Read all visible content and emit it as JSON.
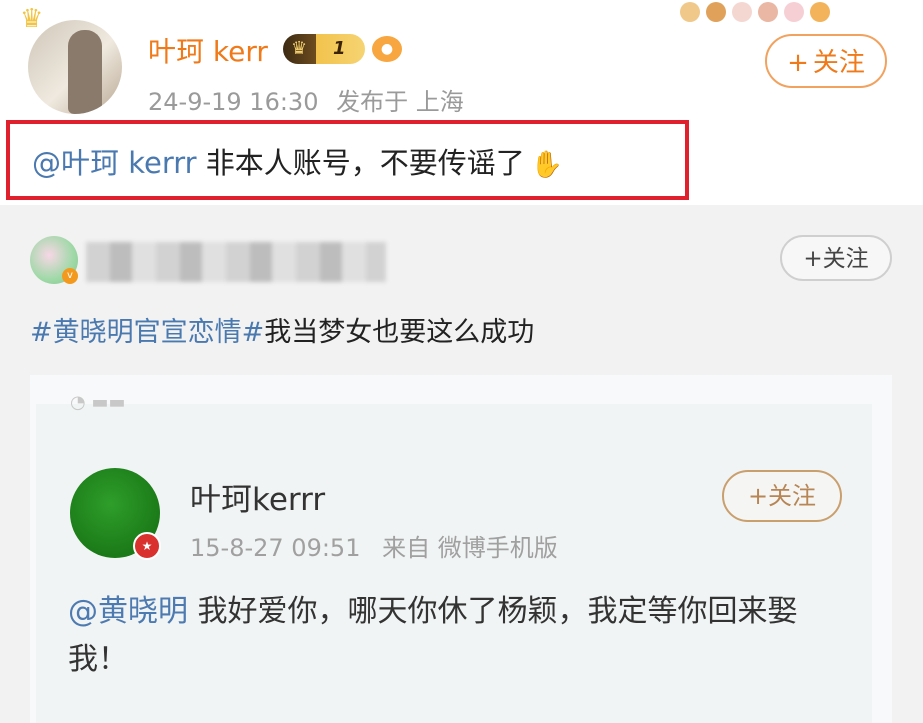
{
  "post_top": {
    "user_name": "叶珂 kerr",
    "vip_level": "1",
    "timestamp": "24-9-19 16:30",
    "location_label": "发布于 上海",
    "follow_label": "关注",
    "mention": "@叶珂 kerrr",
    "text": " 非本人账号，不要传谣了"
  },
  "post_second": {
    "follow_label": "关注",
    "hashtag": "#黄晓明官宣恋情#",
    "text": "我当梦女也要这么成功"
  },
  "embedded_post": {
    "user_name": "叶珂kerrr",
    "timestamp": "15-8-27 09:51",
    "source": "来自 微博手机版",
    "follow_label": "关注",
    "mention": "@黄晓明",
    "text": " 我好爱你，哪天你休了杨颖，我定等你回来娶我！"
  },
  "colors": {
    "highlight_border": "#e0202c",
    "username_orange": "#f07a1a",
    "link_blue": "#4a79b0"
  }
}
